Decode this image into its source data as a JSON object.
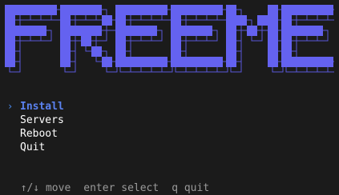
{
  "banner": {
    "text": "FREEME",
    "fill_color": "#6462f0",
    "outline_color": "#5857d8"
  },
  "menu": {
    "cursor_glyph": "›",
    "selected_index": 0,
    "items": [
      {
        "label": "Install"
      },
      {
        "label": "Servers"
      },
      {
        "label": "Reboot"
      },
      {
        "label": "Quit"
      }
    ]
  },
  "help": {
    "move": "↑/↓ move",
    "select": "enter select",
    "quit": "q quit"
  }
}
